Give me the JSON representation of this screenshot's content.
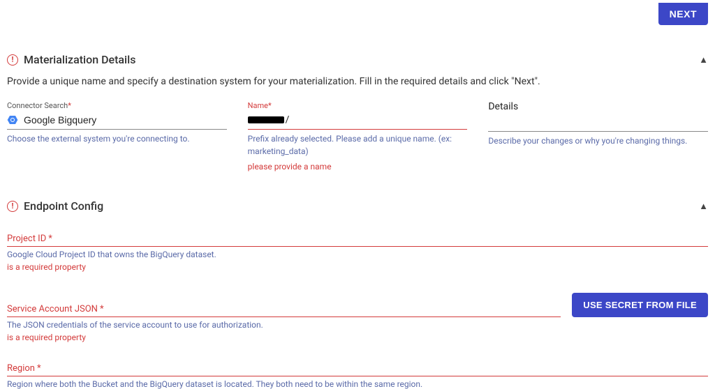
{
  "topbar": {
    "next_label": "NEXT"
  },
  "materialization": {
    "title": "Materialization Details",
    "description": "Provide a unique name and specify a destination system for your materialization. Fill in the required details and click \"Next\".",
    "connector": {
      "label": "Connector Search",
      "value": "Google Bigquery",
      "help": "Choose the external system you're connecting to."
    },
    "name": {
      "label": "Name",
      "suffix": "/",
      "help": "Prefix already selected. Please add a unique name. (ex: marketing_data)",
      "error": "please provide a name"
    },
    "details": {
      "label": "Details",
      "help": "Describe your changes or why you're changing things."
    }
  },
  "endpoint": {
    "title": "Endpoint Config",
    "project_id": {
      "label": "Project ID",
      "help": "Google Cloud Project ID that owns the BigQuery dataset.",
      "error": "is a required property"
    },
    "service_account": {
      "label": "Service Account JSON",
      "help": "The JSON credentials of the service account to use for authorization.",
      "error": "is a required property",
      "secret_button": "USE SECRET FROM FILE"
    },
    "region": {
      "label": "Region",
      "help": "Region where both the Bucket and the BigQuery dataset is located. They both need to be within the same region."
    }
  },
  "glyphs": {
    "required": "*"
  }
}
